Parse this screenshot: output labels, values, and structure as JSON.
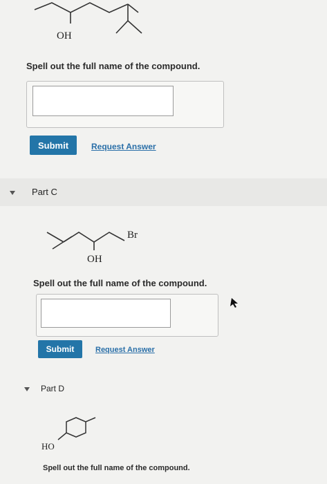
{
  "partB": {
    "oh_label": "OH",
    "prompt": "Spell out the full name of the compound.",
    "answer_value": "",
    "submit_label": "Submit",
    "request_label": "Request Answer"
  },
  "partC": {
    "title": "Part C",
    "br_label": "Br",
    "oh_label": "OH",
    "prompt": "Spell out the full name of the compound.",
    "answer_value": "",
    "submit_label": "Submit",
    "request_label": "Request Answer"
  },
  "partD": {
    "title": "Part D",
    "ho_label": "HO",
    "prompt": "Spell out the full name of the compound."
  },
  "colors": {
    "submit_bg": "#2375a8",
    "link": "#2a6fa8",
    "page_bg": "#f2f2f0"
  }
}
